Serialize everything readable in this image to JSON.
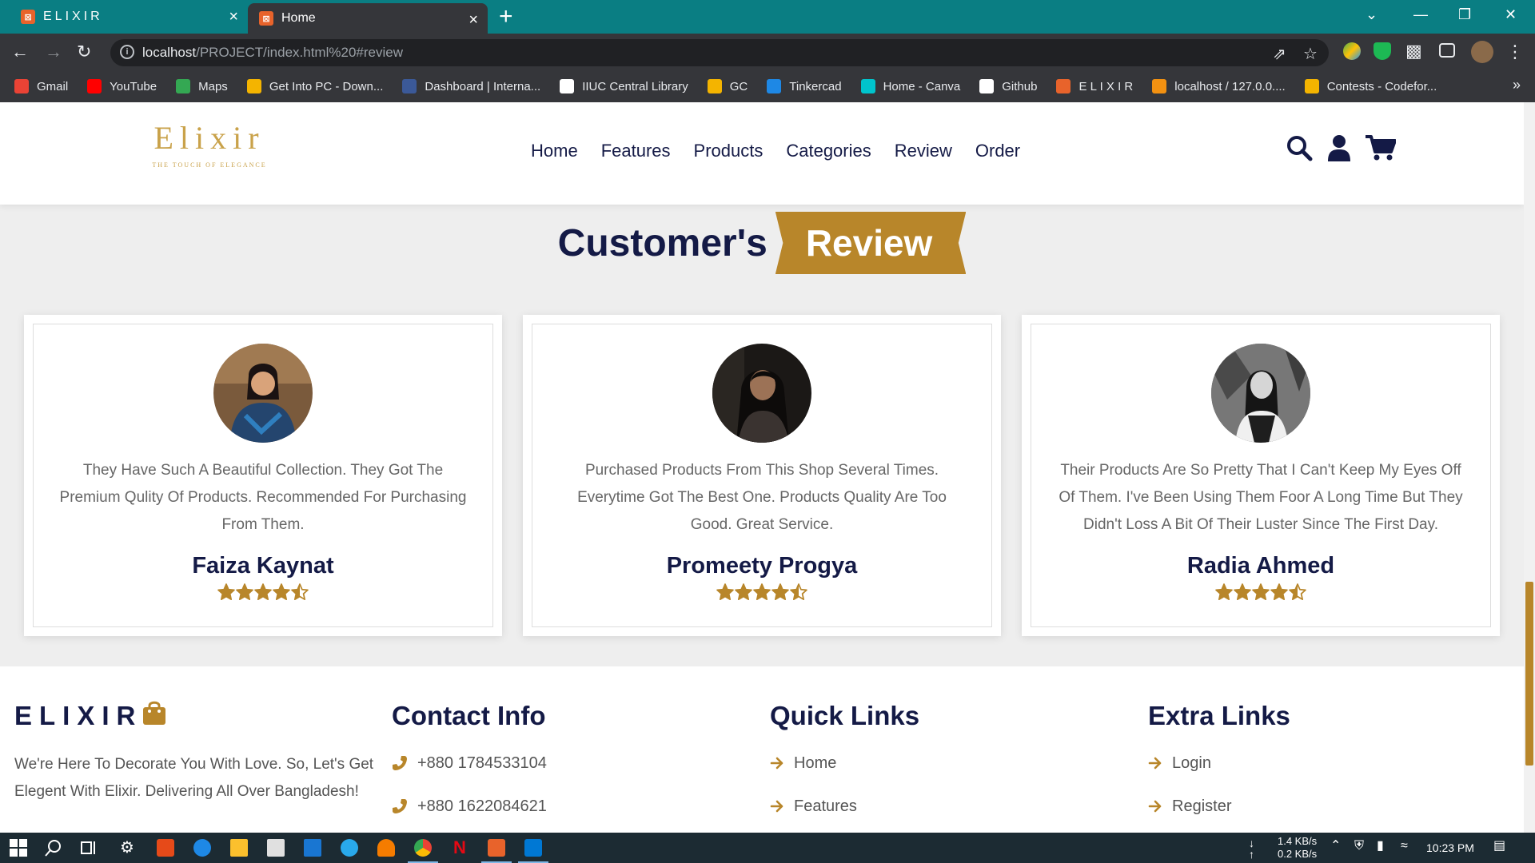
{
  "browser": {
    "tabs": [
      {
        "title": "ELIXIR",
        "active": false
      },
      {
        "title": "Home",
        "active": true
      }
    ],
    "url_host": "localhost",
    "url_path": "/PROJECT/index.html%20#review",
    "bookmarks": [
      {
        "label": "Gmail",
        "color": "#ea4335"
      },
      {
        "label": "YouTube",
        "color": "#ff0000"
      },
      {
        "label": "Maps",
        "color": "#34a853"
      },
      {
        "label": "Get Into PC - Down...",
        "color": "#f4b400"
      },
      {
        "label": "Dashboard | Interna...",
        "color": "#3b5998"
      },
      {
        "label": "IIUC Central Library",
        "color": "#ffffff"
      },
      {
        "label": "GC",
        "color": "#f4b400"
      },
      {
        "label": "Tinkercad",
        "color": "#1e88e5"
      },
      {
        "label": "Home - Canva",
        "color": "#00c4cc"
      },
      {
        "label": "Github",
        "color": "#ffffff"
      },
      {
        "label": "E L I X I R",
        "color": "#e8632b"
      },
      {
        "label": "localhost / 127.0.0....",
        "color": "#f29111"
      },
      {
        "label": "Contests - Codefor...",
        "color": "#f4b400"
      }
    ]
  },
  "site": {
    "logo_word": "Elixir",
    "logo_tagline": "THE TOUCH OF ELEGANCE",
    "nav": [
      "Home",
      "Features",
      "Products",
      "Categories",
      "Review",
      "Order"
    ],
    "heading_dark": "Customer's",
    "heading_badge": "Review",
    "reviews": [
      {
        "text": "They Have Such A Beautiful Collection. They Got The Premium Qulity Of Products. Recommended For Purchasing From Them.",
        "name": "Faiza Kaynat",
        "rating": 4.5
      },
      {
        "text": "Purchased Products From This Shop Several Times. Everytime Got The Best One. Products Quality Are Too Good. Great Service.",
        "name": "Promeety Progya",
        "rating": 4.5
      },
      {
        "text": "Their Products Are So Pretty That I Can't Keep My Eyes Off Of Them. I've Been Using Them Foor A Long Time But They Didn't Loss A Bit Of Their Luster Since The First Day.",
        "name": "Radia Ahmed",
        "rating": 4.5
      }
    ],
    "footer": {
      "brand": "ELIXIR",
      "about": "We're Here To Decorate You With Love. So, Let's Get Elegent With Elixir. Delivering All Over Bangladesh!",
      "contact_title": "Contact Info",
      "phones": [
        "+880 1784533104",
        "+880 1622084621"
      ],
      "quick_title": "Quick Links",
      "quick_links": [
        "Home",
        "Features"
      ],
      "extra_title": "Extra Links",
      "extra_links": [
        "Login",
        "Register"
      ]
    },
    "accent_color": "#b8862a",
    "dark_color": "#141a46"
  },
  "taskbar": {
    "net_down": "1.4 KB/s",
    "net_up": "0.2 KB/s",
    "time": "10:23 PM"
  }
}
